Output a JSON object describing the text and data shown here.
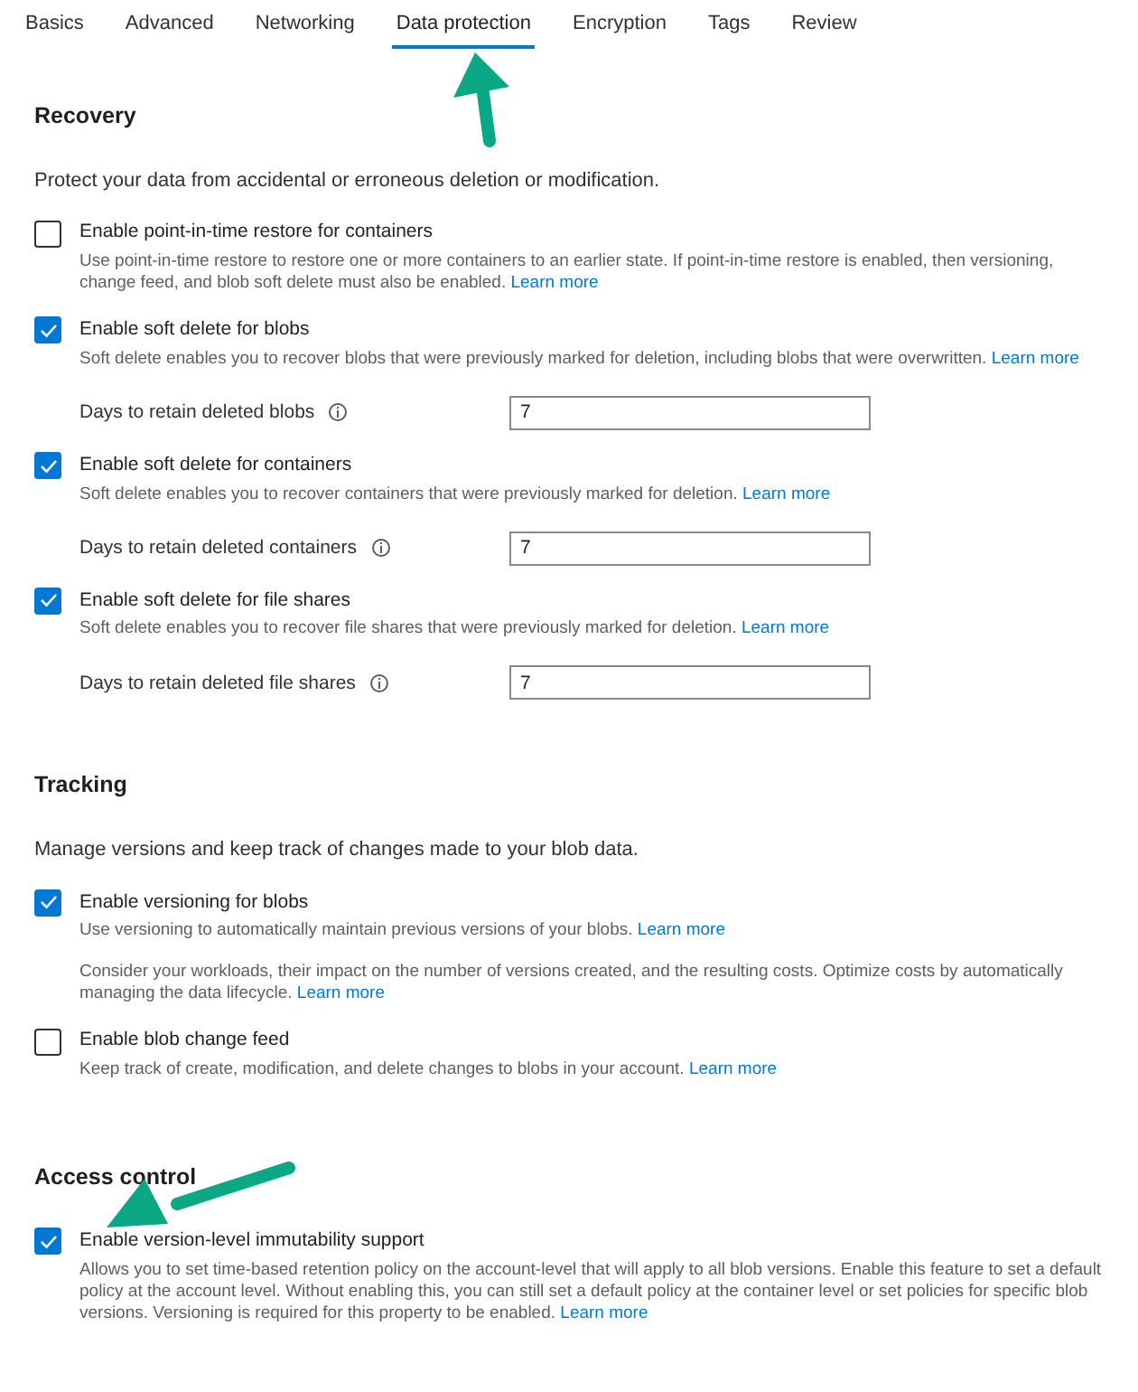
{
  "tabs": [
    {
      "label": "Basics",
      "selected": false
    },
    {
      "label": "Advanced",
      "selected": false
    },
    {
      "label": "Networking",
      "selected": false
    },
    {
      "label": "Data protection",
      "selected": true
    },
    {
      "label": "Encryption",
      "selected": false
    },
    {
      "label": "Tags",
      "selected": false
    },
    {
      "label": "Review",
      "selected": false
    }
  ],
  "sections": [
    {
      "title": "Recovery",
      "description": "Protect your data from accidental or erroneous deletion or modification.",
      "options": [
        {
          "label": "Enable point-in-time restore for containers",
          "checked": false,
          "description": "Use point-in-time restore to restore one or more containers to an earlier state. If point-in-time restore is enabled, then versioning, change feed, and blob soft delete must also be enabled.",
          "link": "Learn more"
        },
        {
          "label": "Enable soft delete for blobs",
          "checked": true,
          "description": "Soft delete enables you to recover blobs that were previously marked for deletion, including blobs that were overwritten.",
          "link": "Learn more",
          "field": {
            "label": "Days to retain deleted blobs",
            "value": "7"
          }
        },
        {
          "label": "Enable soft delete for containers",
          "checked": true,
          "description": "Soft delete enables you to recover containers that were previously marked for deletion.",
          "link": "Learn more",
          "field": {
            "label": "Days to retain deleted containers",
            "value": "7"
          }
        },
        {
          "label": "Enable soft delete for file shares",
          "checked": true,
          "description": "Soft delete enables you to recover file shares that were previously marked for deletion.",
          "link": "Learn more",
          "field": {
            "label": "Days to retain deleted file shares",
            "value": "7"
          }
        }
      ]
    },
    {
      "title": "Tracking",
      "description": "Manage versions and keep track of changes made to your blob data.",
      "options": [
        {
          "label": "Enable versioning for blobs",
          "checked": true,
          "description": "Use versioning to automatically maintain previous versions of your blobs.",
          "link": "Learn more",
          "note": {
            "text": "Consider your workloads, their impact on the number of versions created, and the resulting costs. Optimize costs by automatically managing the data lifecycle.",
            "link": "Learn more"
          }
        },
        {
          "label": "Enable blob change feed",
          "checked": false,
          "description": "Keep track of create, modification, and delete changes to blobs in your account.",
          "link": "Learn more"
        }
      ]
    },
    {
      "title": "Access control",
      "options": [
        {
          "label": "Enable version-level immutability support",
          "checked": true,
          "description": "Allows you to set time-based retention policy on the account-level that will apply to all blob versions. Enable this feature to set a default policy at the account level. Without enabling this, you can still set a default policy at the container level or set policies for specific blob versions. Versioning is required for this property to be enabled.",
          "link": "Learn more"
        }
      ]
    }
  ]
}
